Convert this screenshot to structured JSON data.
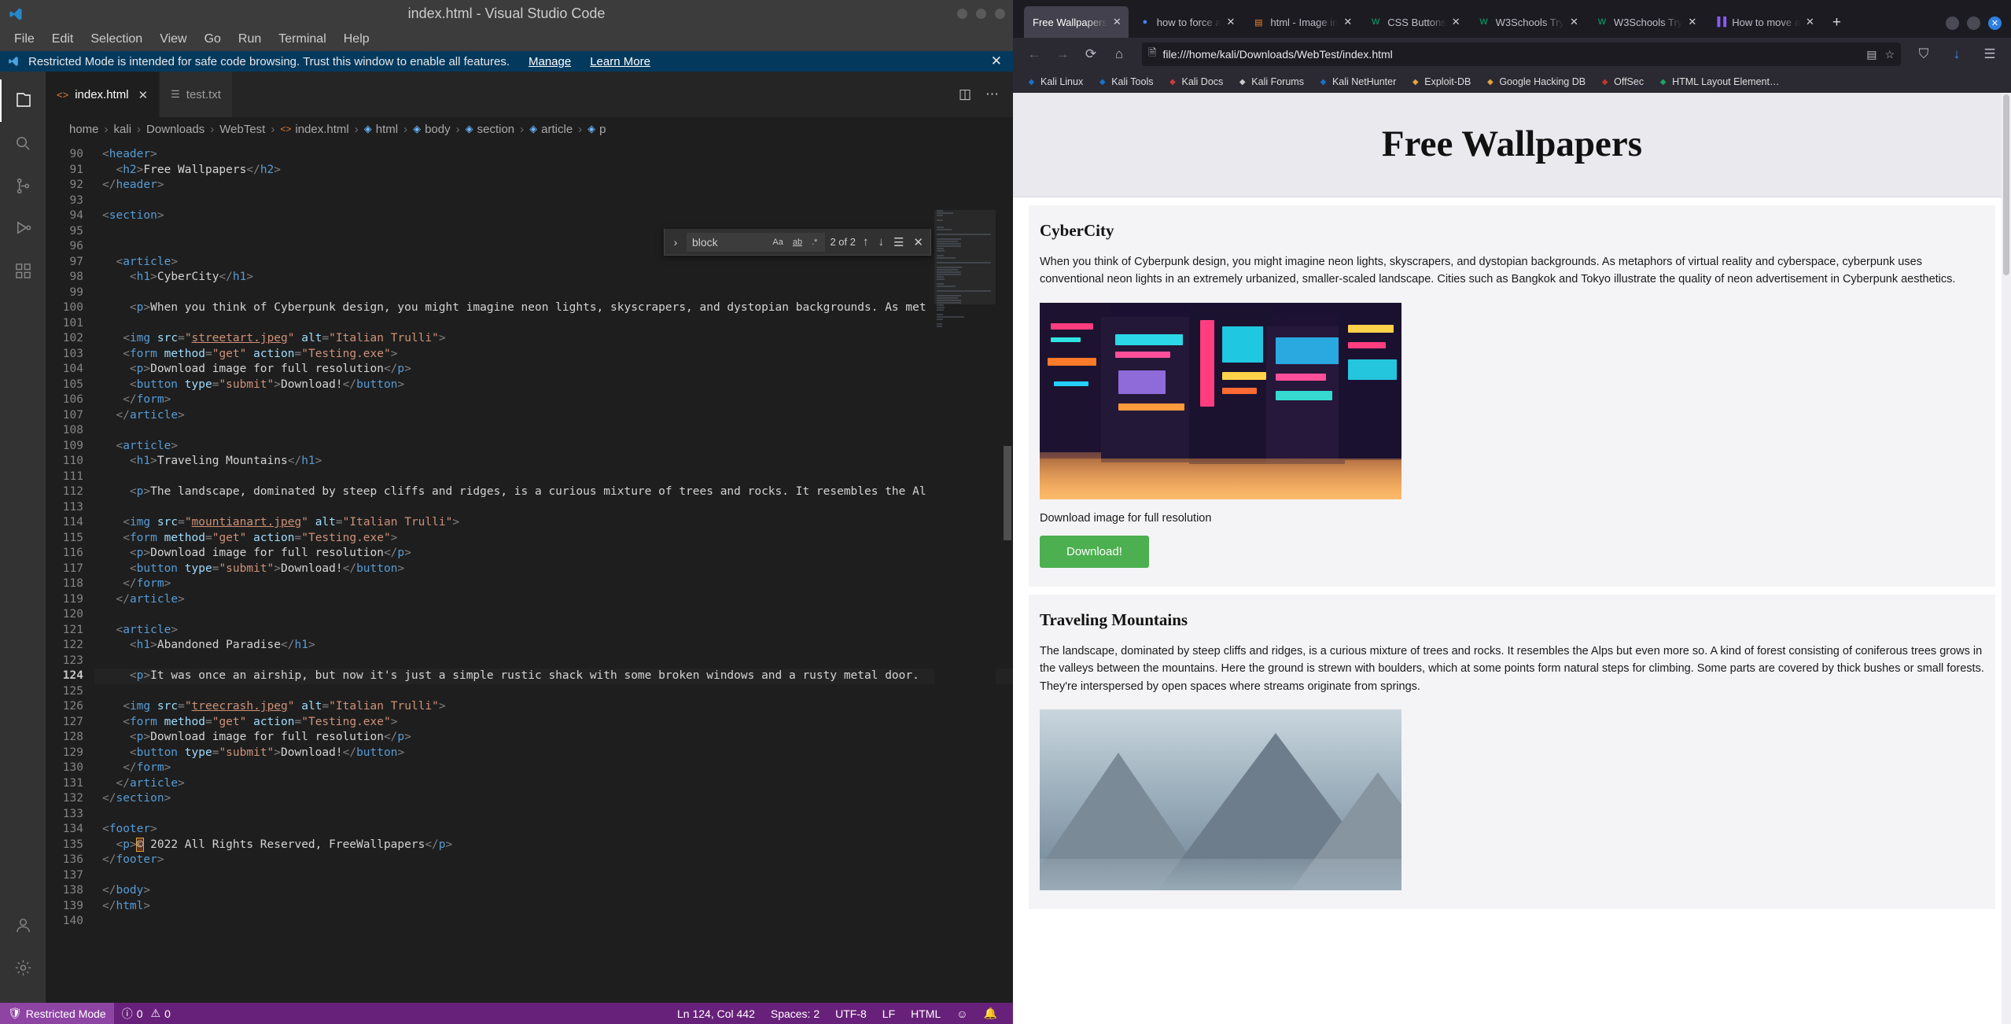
{
  "vscode": {
    "window_title": "index.html - Visual Studio Code",
    "menu": [
      "File",
      "Edit",
      "Selection",
      "View",
      "Go",
      "Run",
      "Terminal",
      "Help"
    ],
    "notification": {
      "text": "Restricted Mode is intended for safe code browsing. Trust this window to enable all features.",
      "manage_label": "Manage",
      "learn_more_label": "Learn More",
      "close_label": "✕"
    },
    "tabs": [
      {
        "label": "index.html",
        "icon": "html-file-icon",
        "active": true,
        "close": "✕"
      },
      {
        "label": "test.txt",
        "icon": "text-file-icon",
        "active": false,
        "close": ""
      }
    ],
    "breadcrumb": [
      "home",
      "kali",
      "Downloads",
      "WebTest",
      "index.html",
      "html",
      "body",
      "section",
      "article",
      "p"
    ],
    "find": {
      "value": "block",
      "match_case_label": "Aa",
      "whole_word_label": "ab",
      "regex_label": ".*",
      "count": "2 of 2",
      "prev_label": "↑",
      "next_label": "↓",
      "selection_label": "☰",
      "close_label": "✕"
    },
    "code_lines": [
      {
        "n": 90,
        "html": "<span class='t-punct'>&lt;</span><span class='t-tag'>header</span><span class='t-punct'>&gt;</span>"
      },
      {
        "n": 91,
        "html": "  <span class='t-punct'>&lt;</span><span class='t-tag'>h2</span><span class='t-punct'>&gt;</span><span class='t-txt'>Free Wallpapers</span><span class='t-punct'>&lt;/</span><span class='t-tag'>h2</span><span class='t-punct'>&gt;</span>"
      },
      {
        "n": 92,
        "html": "<span class='t-punct'>&lt;/</span><span class='t-tag'>header</span><span class='t-punct'>&gt;</span>"
      },
      {
        "n": 93,
        "html": ""
      },
      {
        "n": 94,
        "html": "<span class='t-punct'>&lt;</span><span class='t-tag'>section</span><span class='t-punct'>&gt;</span>"
      },
      {
        "n": 95,
        "html": ""
      },
      {
        "n": 96,
        "html": ""
      },
      {
        "n": 97,
        "html": "  <span class='t-punct'>&lt;</span><span class='t-tag'>article</span><span class='t-punct'>&gt;</span>"
      },
      {
        "n": 98,
        "html": "    <span class='t-punct'>&lt;</span><span class='t-tag'>h1</span><span class='t-punct'>&gt;</span><span class='t-txt'>CyberCity</span><span class='t-punct'>&lt;/</span><span class='t-tag'>h1</span><span class='t-punct'>&gt;</span>"
      },
      {
        "n": 99,
        "html": ""
      },
      {
        "n": 100,
        "html": "    <span class='t-punct'>&lt;</span><span class='t-tag'>p</span><span class='t-punct'>&gt;</span><span class='t-txt'>When you think of Cyberpunk design, you might imagine neon lights, skyscrapers, and dystopian backgrounds. As met</span>"
      },
      {
        "n": 101,
        "html": ""
      },
      {
        "n": 102,
        "html": "   <span class='t-punct'>&lt;</span><span class='t-tag'>img</span> <span class='t-attr'>src</span><span class='t-punct'>=</span><span class='t-str'>\"</span><span class='t-link'>streetart.jpeg</span><span class='t-str'>\"</span> <span class='t-attr'>alt</span><span class='t-punct'>=</span><span class='t-str'>\"Italian Trulli\"</span><span class='t-punct'>&gt;</span>"
      },
      {
        "n": 103,
        "html": "   <span class='t-punct'>&lt;</span><span class='t-tag'>form</span> <span class='t-attr'>method</span><span class='t-punct'>=</span><span class='t-str'>\"get\"</span> <span class='t-attr'>action</span><span class='t-punct'>=</span><span class='t-str'>\"Testing.exe\"</span><span class='t-punct'>&gt;</span>"
      },
      {
        "n": 104,
        "html": "    <span class='t-punct'>&lt;</span><span class='t-tag'>p</span><span class='t-punct'>&gt;</span><span class='t-txt'>Download image for full resolution</span><span class='t-punct'>&lt;/</span><span class='t-tag'>p</span><span class='t-punct'>&gt;</span>"
      },
      {
        "n": 105,
        "html": "    <span class='t-punct'>&lt;</span><span class='t-tag'>button</span> <span class='t-attr'>type</span><span class='t-punct'>=</span><span class='t-str'>\"submit\"</span><span class='t-punct'>&gt;</span><span class='t-txt'>Download!</span><span class='t-punct'>&lt;/</span><span class='t-tag'>button</span><span class='t-punct'>&gt;</span>"
      },
      {
        "n": 106,
        "html": "   <span class='t-punct'>&lt;/</span><span class='t-tag'>form</span><span class='t-punct'>&gt;</span>"
      },
      {
        "n": 107,
        "html": "  <span class='t-punct'>&lt;/</span><span class='t-tag'>article</span><span class='t-punct'>&gt;</span>"
      },
      {
        "n": 108,
        "html": ""
      },
      {
        "n": 109,
        "html": "  <span class='t-punct'>&lt;</span><span class='t-tag'>article</span><span class='t-punct'>&gt;</span>"
      },
      {
        "n": 110,
        "html": "    <span class='t-punct'>&lt;</span><span class='t-tag'>h1</span><span class='t-punct'>&gt;</span><span class='t-txt'>Traveling Mountains</span><span class='t-punct'>&lt;/</span><span class='t-tag'>h1</span><span class='t-punct'>&gt;</span>"
      },
      {
        "n": 111,
        "html": ""
      },
      {
        "n": 112,
        "html": "    <span class='t-punct'>&lt;</span><span class='t-tag'>p</span><span class='t-punct'>&gt;</span><span class='t-txt'>The landscape, dominated by steep cliffs and ridges, is a curious mixture of trees and rocks. It resembles the Al</span>"
      },
      {
        "n": 113,
        "html": ""
      },
      {
        "n": 114,
        "html": "   <span class='t-punct'>&lt;</span><span class='t-tag'>img</span> <span class='t-attr'>src</span><span class='t-punct'>=</span><span class='t-str'>\"</span><span class='t-link'>mountianart.jpeg</span><span class='t-str'>\"</span> <span class='t-attr'>alt</span><span class='t-punct'>=</span><span class='t-str'>\"Italian Trulli\"</span><span class='t-punct'>&gt;</span>"
      },
      {
        "n": 115,
        "html": "   <span class='t-punct'>&lt;</span><span class='t-tag'>form</span> <span class='t-attr'>method</span><span class='t-punct'>=</span><span class='t-str'>\"get\"</span> <span class='t-attr'>action</span><span class='t-punct'>=</span><span class='t-str'>\"Testing.exe\"</span><span class='t-punct'>&gt;</span>"
      },
      {
        "n": 116,
        "html": "    <span class='t-punct'>&lt;</span><span class='t-tag'>p</span><span class='t-punct'>&gt;</span><span class='t-txt'>Download image for full resolution</span><span class='t-punct'>&lt;/</span><span class='t-tag'>p</span><span class='t-punct'>&gt;</span>"
      },
      {
        "n": 117,
        "html": "    <span class='t-punct'>&lt;</span><span class='t-tag'>button</span> <span class='t-attr'>type</span><span class='t-punct'>=</span><span class='t-str'>\"submit\"</span><span class='t-punct'>&gt;</span><span class='t-txt'>Download!</span><span class='t-punct'>&lt;/</span><span class='t-tag'>button</span><span class='t-punct'>&gt;</span>"
      },
      {
        "n": 118,
        "html": "   <span class='t-punct'>&lt;/</span><span class='t-tag'>form</span><span class='t-punct'>&gt;</span>"
      },
      {
        "n": 119,
        "html": "  <span class='t-punct'>&lt;/</span><span class='t-tag'>article</span><span class='t-punct'>&gt;</span>"
      },
      {
        "n": 120,
        "html": ""
      },
      {
        "n": 121,
        "html": "  <span class='t-punct'>&lt;</span><span class='t-tag'>article</span><span class='t-punct'>&gt;</span>"
      },
      {
        "n": 122,
        "html": "    <span class='t-punct'>&lt;</span><span class='t-tag'>h1</span><span class='t-punct'>&gt;</span><span class='t-txt'>Abandoned Paradise</span><span class='t-punct'>&lt;/</span><span class='t-tag'>h1</span><span class='t-punct'>&gt;</span>"
      },
      {
        "n": 123,
        "html": ""
      },
      {
        "n": 124,
        "cur": true,
        "html": "    <span class='t-punct'>&lt;</span><span class='t-tag'>p</span><span class='t-punct'>&gt;</span><span class='t-txt'>It was once an airship, but now it's just a simple rustic shack with some broken windows and a rusty metal door.</span>"
      },
      {
        "n": 125,
        "html": ""
      },
      {
        "n": 126,
        "html": "   <span class='t-punct'>&lt;</span><span class='t-tag'>img</span> <span class='t-attr'>src</span><span class='t-punct'>=</span><span class='t-str'>\"</span><span class='t-link'>treecrash.jpeg</span><span class='t-str'>\"</span> <span class='t-attr'>alt</span><span class='t-punct'>=</span><span class='t-str'>\"Italian Trulli\"</span><span class='t-punct'>&gt;</span>"
      },
      {
        "n": 127,
        "html": "   <span class='t-punct'>&lt;</span><span class='t-tag'>form</span> <span class='t-attr'>method</span><span class='t-punct'>=</span><span class='t-str'>\"get\"</span> <span class='t-attr'>action</span><span class='t-punct'>=</span><span class='t-str'>\"Testing.exe\"</span><span class='t-punct'>&gt;</span>"
      },
      {
        "n": 128,
        "html": "    <span class='t-punct'>&lt;</span><span class='t-tag'>p</span><span class='t-punct'>&gt;</span><span class='t-txt'>Download image for full resolution</span><span class='t-punct'>&lt;/</span><span class='t-tag'>p</span><span class='t-punct'>&gt;</span>"
      },
      {
        "n": 129,
        "html": "    <span class='t-punct'>&lt;</span><span class='t-tag'>button</span> <span class='t-attr'>type</span><span class='t-punct'>=</span><span class='t-str'>\"submit\"</span><span class='t-punct'>&gt;</span><span class='t-txt'>Download!</span><span class='t-punct'>&lt;/</span><span class='t-tag'>button</span><span class='t-punct'>&gt;</span>"
      },
      {
        "n": 130,
        "html": "   <span class='t-punct'>&lt;/</span><span class='t-tag'>form</span><span class='t-punct'>&gt;</span>"
      },
      {
        "n": 131,
        "html": "  <span class='t-punct'>&lt;/</span><span class='t-tag'>article</span><span class='t-punct'>&gt;</span>"
      },
      {
        "n": 132,
        "html": "<span class='t-punct'>&lt;/</span><span class='t-tag'>section</span><span class='t-punct'>&gt;</span>"
      },
      {
        "n": 133,
        "html": ""
      },
      {
        "n": 134,
        "html": "<span class='t-punct'>&lt;</span><span class='t-tag'>footer</span><span class='t-punct'>&gt;</span>"
      },
      {
        "n": 135,
        "html": "  <span class='t-punct'>&lt;</span><span class='t-tag'>p</span><span class='t-punct'>&gt;</span><span class='hl-sel t-txt'>©</span><span class='t-txt'> 2022 All Rights Reserved, FreeWallpapers</span><span class='t-punct'>&lt;/</span><span class='t-tag'>p</span><span class='t-punct'>&gt;</span>"
      },
      {
        "n": 136,
        "html": "<span class='t-punct'>&lt;/</span><span class='t-tag'>footer</span><span class='t-punct'>&gt;</span>"
      },
      {
        "n": 137,
        "html": ""
      },
      {
        "n": 138,
        "html": "<span class='t-punct'>&lt;/</span><span class='t-tag'>body</span><span class='t-punct'>&gt;</span>"
      },
      {
        "n": 139,
        "html": "<span class='t-punct'>&lt;/</span><span class='t-tag'>html</span><span class='t-punct'>&gt;</span>"
      },
      {
        "n": 140,
        "html": ""
      }
    ],
    "statusbar": {
      "restricted_label": "Restricted Mode",
      "errors": "0",
      "warnings": "0",
      "position": "Ln 124, Col 442",
      "spaces": "Spaces: 2",
      "encoding": "UTF-8",
      "eol": "LF",
      "language": "HTML",
      "feedback_icon": "smiley-icon",
      "bell_icon": "bell-icon"
    }
  },
  "browser": {
    "tabs": [
      {
        "label": "Free Wallpapers",
        "favicon": "",
        "active": true
      },
      {
        "label": "how to force a",
        "favicon": "google-icon",
        "active": false
      },
      {
        "label": "html - Image in",
        "favicon": "stack-overflow-icon",
        "active": false
      },
      {
        "label": "CSS Buttons",
        "favicon": "w3schools-icon",
        "active": false
      },
      {
        "label": "W3Schools Try",
        "favicon": "w3schools-icon",
        "active": false
      },
      {
        "label": "W3Schools Try",
        "favicon": "w3schools-icon",
        "active": false
      },
      {
        "label": "How to move a",
        "favicon": "bars-icon",
        "active": false
      }
    ],
    "new_tab_label": "+",
    "nav": {
      "back_label": "←",
      "forward_label": "→",
      "reload_label": "⟳",
      "home_label": "⌂",
      "url": "file:///home/kali/Downloads/WebTest/index.html",
      "reader_label": "▤",
      "bookmark_label": "☆",
      "shield_label": "⛉",
      "downloads_label": "↓",
      "menu_label": "☰"
    },
    "bookmarks": [
      {
        "label": "Kali Linux",
        "icon": "kali-dragon-icon",
        "color": "#1a73c9"
      },
      {
        "label": "Kali Tools",
        "icon": "kali-dragon-icon",
        "color": "#1a73c9"
      },
      {
        "label": "Kali Docs",
        "icon": "kali-docs-icon",
        "color": "#d13b3b"
      },
      {
        "label": "Kali Forums",
        "icon": "forum-icon",
        "color": "#cccccc"
      },
      {
        "label": "Kali NetHunter",
        "icon": "nethunter-icon",
        "color": "#1a73c9"
      },
      {
        "label": "Exploit-DB",
        "icon": "exploitdb-icon",
        "color": "#e8a33d"
      },
      {
        "label": "Google Hacking DB",
        "icon": "google-hacking-icon",
        "color": "#e8a33d"
      },
      {
        "label": "OffSec",
        "icon": "offsec-icon",
        "color": "#c0392b"
      },
      {
        "label": "HTML Layout Element…",
        "icon": "w3schools-icon",
        "color": "#21a366"
      }
    ]
  },
  "page": {
    "header_title": "Free Wallpapers",
    "articles": [
      {
        "title": "CyberCity",
        "paragraph": "When you think of Cyberpunk design, you might imagine neon lights, skyscrapers, and dystopian backgrounds. As metaphors of virtual reality and cyberspace, cyberpunk uses conventional neon lights in an extremely urbanized, smaller-scaled landscape. Cities such as Bangkok and Tokyo illustrate the quality of neon advertisement in Cyberpunk aesthetics.",
        "image_alt": "Italian Trulli",
        "caption": "Download image for full resolution",
        "button_label": "Download!"
      },
      {
        "title": "Traveling Mountains",
        "paragraph": "The landscape, dominated by steep cliffs and ridges, is a curious mixture of trees and rocks. It resembles the Alps but even more so. A kind of forest consisting of coniferous trees grows in the valleys between the mountains. Here the ground is strewn with boulders, which at some points form natural steps for climbing. Some parts are covered by thick bushes or small forests. They're interspersed by open spaces where streams originate from springs.",
        "image_alt": "Italian Trulli",
        "caption": "Download image for full resolution",
        "button_label": "Download!"
      }
    ],
    "accent_color": "#4CAF50"
  }
}
